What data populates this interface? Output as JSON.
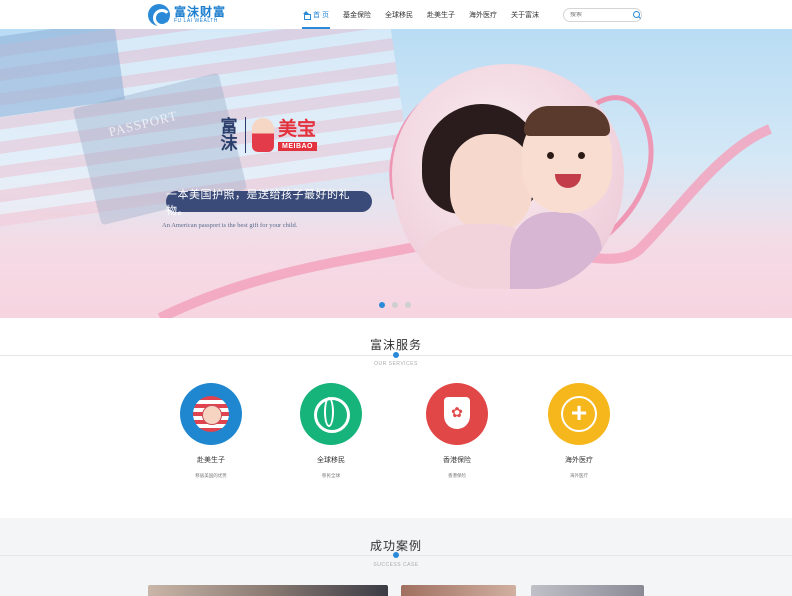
{
  "header": {
    "logo_cn": "富沫财富",
    "logo_en": "FU LAI WEALTH",
    "nav": [
      {
        "label": "首 页",
        "active": true
      },
      {
        "label": "基金保险",
        "active": false
      },
      {
        "label": "全球移民",
        "active": false
      },
      {
        "label": "赴美生子",
        "active": false
      },
      {
        "label": "海外医疗",
        "active": false
      },
      {
        "label": "关于富沫",
        "active": false
      }
    ],
    "search_placeholder": "搜索"
  },
  "banner": {
    "passport_text": "PASSPORT",
    "brand_left": "富沫",
    "brand_cn": "美宝",
    "brand_en": "MEIBAO",
    "slogan": "一本美国护照，是送给孩子最好的礼物。",
    "slogan_en": "An American passport is the best gift for your child.",
    "slides": 3,
    "active_slide": 0
  },
  "services": {
    "title": "富沫服务",
    "subtitle": "OUR SERVICES",
    "items": [
      {
        "name": "赴美生子",
        "icon": "us-flag-baby-icon",
        "color": "#1f87cf",
        "desc": "移居美国的优势",
        "desc_text": "移居美国的优势"
      },
      {
        "name": "全球移民",
        "icon": "globe-icon",
        "color": "#16b47b",
        "desc_text": "移民全球"
      },
      {
        "name": "香港保险",
        "icon": "hong-kong-shield-icon",
        "color": "#e24747",
        "desc_text": "香港保险"
      },
      {
        "name": "海外医疗",
        "icon": "medical-cross-icon",
        "color": "#f5b71c",
        "desc_text": "海外医疗"
      }
    ]
  },
  "cases": {
    "title": "成功案例",
    "subtitle": "SUCCESS CASE"
  }
}
